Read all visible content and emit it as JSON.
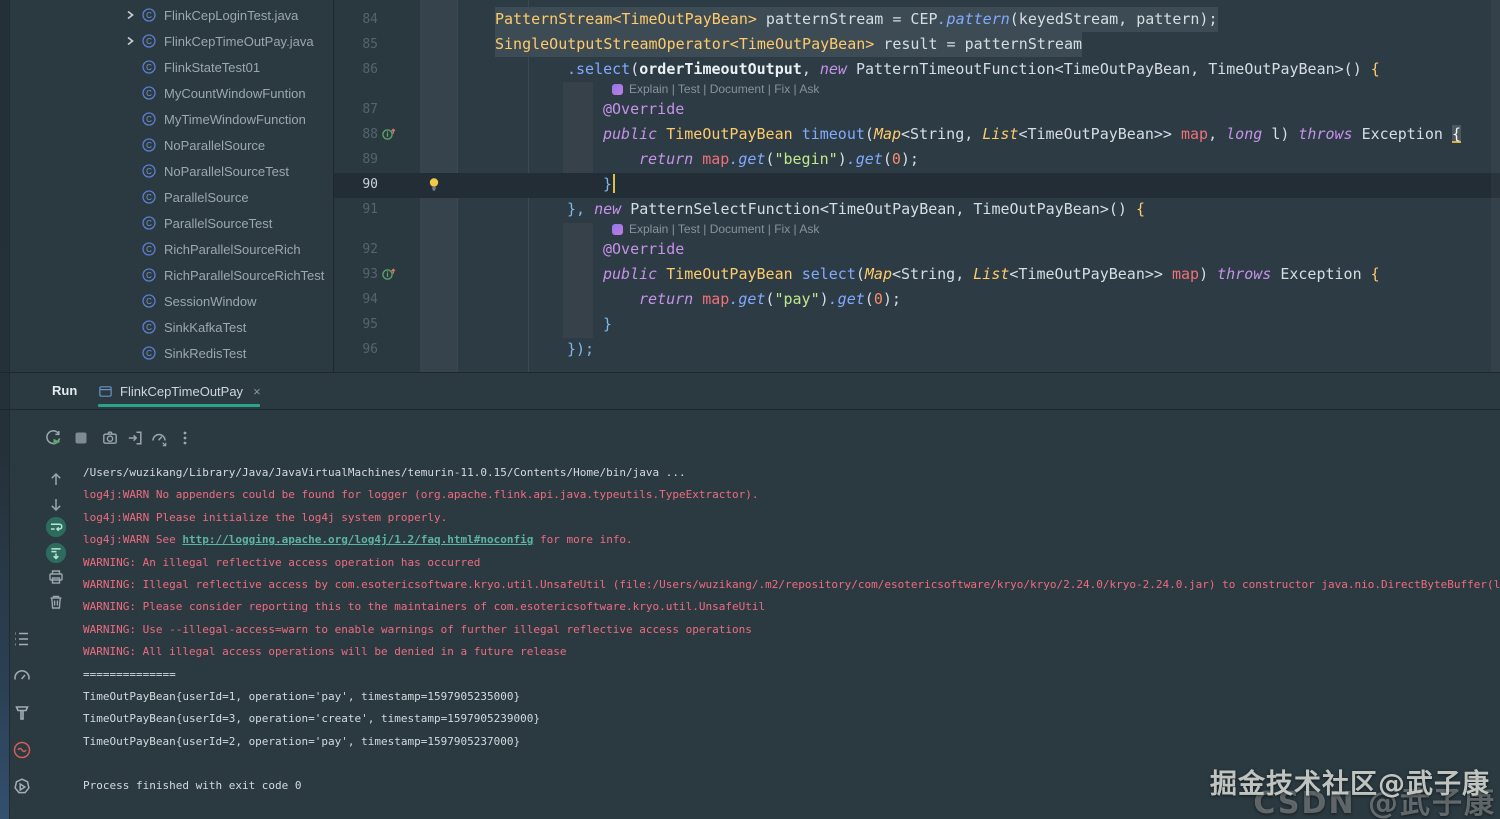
{
  "colors": {
    "accent_teal": "#2aa38c",
    "error_red": "#ee6c7f",
    "link_teal": "#5cb5a2",
    "selection": "#3d4b54",
    "class_yellow": "#ffcb6b",
    "keyword_purple": "#c792ea",
    "method_blue": "#82aaff",
    "string_green": "#c3e88d"
  },
  "project_tree": {
    "items": [
      {
        "label": "FlinkCepLoginTest.java",
        "expandable": true
      },
      {
        "label": "FlinkCepTimeOutPay.java",
        "expandable": true
      },
      {
        "label": "FlinkStateTest01",
        "expandable": false
      },
      {
        "label": "MyCountWindowFuntion",
        "expandable": false
      },
      {
        "label": "MyTimeWindowFunction",
        "expandable": false
      },
      {
        "label": "NoParallelSource",
        "expandable": false
      },
      {
        "label": "NoParallelSourceTest",
        "expandable": false
      },
      {
        "label": "ParallelSource",
        "expandable": false
      },
      {
        "label": "ParallelSourceTest",
        "expandable": false
      },
      {
        "label": "RichParallelSourceRich",
        "expandable": false
      },
      {
        "label": "RichParallelSourceRichTest",
        "expandable": false
      },
      {
        "label": "SessionWindow",
        "expandable": false
      },
      {
        "label": "SinkKafkaTest",
        "expandable": false
      },
      {
        "label": "SinkRedisTest",
        "expandable": false
      }
    ]
  },
  "editor": {
    "ai_hint": "Explain | Test | Document | Fix | Ask",
    "rows": [
      {
        "type": "code",
        "num": "84",
        "col": 8,
        "selected": true,
        "tokens": [
          [
            "cls",
            "PatternStream<TimeOutPayBean>"
          ],
          [
            "plain",
            " patternStream = CEP"
          ],
          [
            "fni",
            ".pattern"
          ],
          [
            "plain",
            "(keyedStream, pattern);"
          ]
        ]
      },
      {
        "type": "code",
        "num": "85",
        "col": 8,
        "selected": true,
        "tokens": [
          [
            "cls",
            "SingleOutputStreamOperator<TimeOutPayBean>"
          ],
          [
            "plain",
            " result = patternStream"
          ]
        ]
      },
      {
        "type": "code",
        "num": "86",
        "col": 16,
        "tokens": [
          [
            "fn",
            ".select"
          ],
          [
            "plain",
            "("
          ],
          [
            "bold",
            "orderTimeoutOutput"
          ],
          [
            "plain",
            ", "
          ],
          [
            "kw",
            "new "
          ],
          [
            "plain",
            "PatternTimeoutFunction<TimeOutPayBean, TimeOutPayBean>() "
          ],
          [
            "ybrace",
            "{"
          ]
        ]
      },
      {
        "type": "hint"
      },
      {
        "type": "code",
        "num": "87",
        "col": 20,
        "tokens": [
          [
            "ann",
            "@Override"
          ]
        ]
      },
      {
        "type": "code",
        "num": "88",
        "col": 20,
        "gutter": "override",
        "tokens": [
          [
            "kw",
            "public "
          ],
          [
            "cls",
            "TimeOutPayBean "
          ],
          [
            "fn",
            "timeout"
          ],
          [
            "plain",
            "("
          ],
          [
            "clsi",
            "Map"
          ],
          [
            "plain",
            "<String, "
          ],
          [
            "clsi",
            "List"
          ],
          [
            "plain",
            "<TimeOutPayBean>> "
          ],
          [
            "param",
            "map"
          ],
          [
            "plain",
            ", "
          ],
          [
            "kw",
            "long "
          ],
          [
            "plain",
            "l) "
          ],
          [
            "kw",
            "throws "
          ],
          [
            "plain",
            "Exception "
          ],
          [
            "bracehl",
            "{"
          ]
        ]
      },
      {
        "type": "code",
        "num": "89",
        "col": 24,
        "tokens": [
          [
            "kw",
            "return "
          ],
          [
            "param",
            "map"
          ],
          [
            "fni",
            ".get"
          ],
          [
            "plain",
            "("
          ],
          [
            "str",
            "\"begin\""
          ],
          [
            "plain",
            ")"
          ],
          [
            "fni",
            ".get"
          ],
          [
            "plain",
            "("
          ],
          [
            "num",
            "0"
          ],
          [
            "plain",
            ");"
          ]
        ]
      },
      {
        "type": "code",
        "num": "90",
        "col": 20,
        "current": true,
        "bulb": true,
        "cursor": true,
        "tokens": [
          [
            "bbrace",
            "}"
          ]
        ]
      },
      {
        "type": "code",
        "num": "91",
        "col": 16,
        "tokens": [
          [
            "bbrace",
            "},"
          ],
          [
            "plain",
            " "
          ],
          [
            "kw",
            "new "
          ],
          [
            "plain",
            "PatternSelectFunction<TimeOutPayBean, TimeOutPayBean>() "
          ],
          [
            "ybrace",
            "{"
          ]
        ]
      },
      {
        "type": "hint"
      },
      {
        "type": "code",
        "num": "92",
        "col": 20,
        "tokens": [
          [
            "ann",
            "@Override"
          ]
        ]
      },
      {
        "type": "code",
        "num": "93",
        "col": 20,
        "gutter": "override",
        "tokens": [
          [
            "kw",
            "public "
          ],
          [
            "cls",
            "TimeOutPayBean "
          ],
          [
            "fn",
            "select"
          ],
          [
            "plain",
            "("
          ],
          [
            "clsi",
            "Map"
          ],
          [
            "plain",
            "<String, "
          ],
          [
            "clsi",
            "List"
          ],
          [
            "plain",
            "<TimeOutPayBean>> "
          ],
          [
            "param",
            "map"
          ],
          [
            "plain",
            ") "
          ],
          [
            "kw",
            "throws "
          ],
          [
            "plain",
            "Exception "
          ],
          [
            "ybrace",
            "{"
          ]
        ]
      },
      {
        "type": "code",
        "num": "94",
        "col": 24,
        "tokens": [
          [
            "kw",
            "return "
          ],
          [
            "param",
            "map"
          ],
          [
            "fni",
            ".get"
          ],
          [
            "plain",
            "("
          ],
          [
            "str",
            "\"pay\""
          ],
          [
            "plain",
            ")"
          ],
          [
            "fni",
            ".get"
          ],
          [
            "plain",
            "("
          ],
          [
            "num",
            "0"
          ],
          [
            "plain",
            ");"
          ]
        ]
      },
      {
        "type": "code",
        "num": "95",
        "col": 20,
        "tokens": [
          [
            "bbrace",
            "}"
          ]
        ]
      },
      {
        "type": "code",
        "num": "96",
        "col": 16,
        "tokens": [
          [
            "bbrace",
            "});"
          ]
        ]
      }
    ]
  },
  "run_panel": {
    "title": "Run",
    "tab": {
      "label": "FlinkCepTimeOutPay",
      "close": "×"
    },
    "toolbar_icons": [
      "rerun",
      "stop",
      "thread-dump",
      "attach",
      "profiler",
      "more"
    ],
    "console_toolbar_icons": [
      "up",
      "down",
      "soft-wrap",
      "scroll-end",
      "print",
      "clear"
    ],
    "console_lines": [
      {
        "style": "plain",
        "text": "/Users/wuzikang/Library/Java/JavaVirtualMachines/temurin-11.0.15/Contents/Home/bin/java ..."
      },
      {
        "style": "error",
        "text": "log4j:WARN No appenders could be found for logger (org.apache.flink.api.java.typeutils.TypeExtractor)."
      },
      {
        "style": "error",
        "text": "log4j:WARN Please initialize the log4j system properly."
      },
      {
        "style": "error",
        "parts": [
          {
            "t": "log4j:WARN See "
          },
          {
            "t": "http://logging.apache.org/log4j/1.2/faq.html#noconfig",
            "link": true
          },
          {
            "t": " for more info."
          }
        ]
      },
      {
        "style": "error",
        "text": "WARNING: An illegal reflective access operation has occurred"
      },
      {
        "style": "error",
        "text": "WARNING: Illegal reflective access by com.esotericsoftware.kryo.util.UnsafeUtil (file:/Users/wuzikang/.m2/repository/com/esotericsoftware/kryo/kryo/2.24.0/kryo-2.24.0.jar) to constructor java.nio.DirectByteBuffer(long,int)"
      },
      {
        "style": "error",
        "text": "WARNING: Please consider reporting this to the maintainers of com.esotericsoftware.kryo.util.UnsafeUtil"
      },
      {
        "style": "error",
        "text": "WARNING: Use --illegal-access=warn to enable warnings of further illegal reflective access operations"
      },
      {
        "style": "error",
        "text": "WARNING: All illegal access operations will be denied in a future release"
      },
      {
        "style": "plain",
        "text": "=============="
      },
      {
        "style": "plain",
        "text": "TimeOutPayBean{userId=1, operation='pay', timestamp=1597905235000}"
      },
      {
        "style": "plain",
        "text": "TimeOutPayBean{userId=3, operation='create', timestamp=1597905239000}"
      },
      {
        "style": "plain",
        "text": "TimeOutPayBean{userId=2, operation='pay', timestamp=1597905237000}"
      },
      {
        "style": "plain",
        "text": ""
      },
      {
        "style": "plain",
        "text": "Process finished with exit code 0"
      }
    ]
  },
  "left_strip_icons": [
    "structure",
    "gauge",
    "hammer",
    "profiler-red",
    "run-anything"
  ],
  "watermark": {
    "line1": "掘金技术社区@武子康",
    "line2": "CSDN @武子康"
  }
}
